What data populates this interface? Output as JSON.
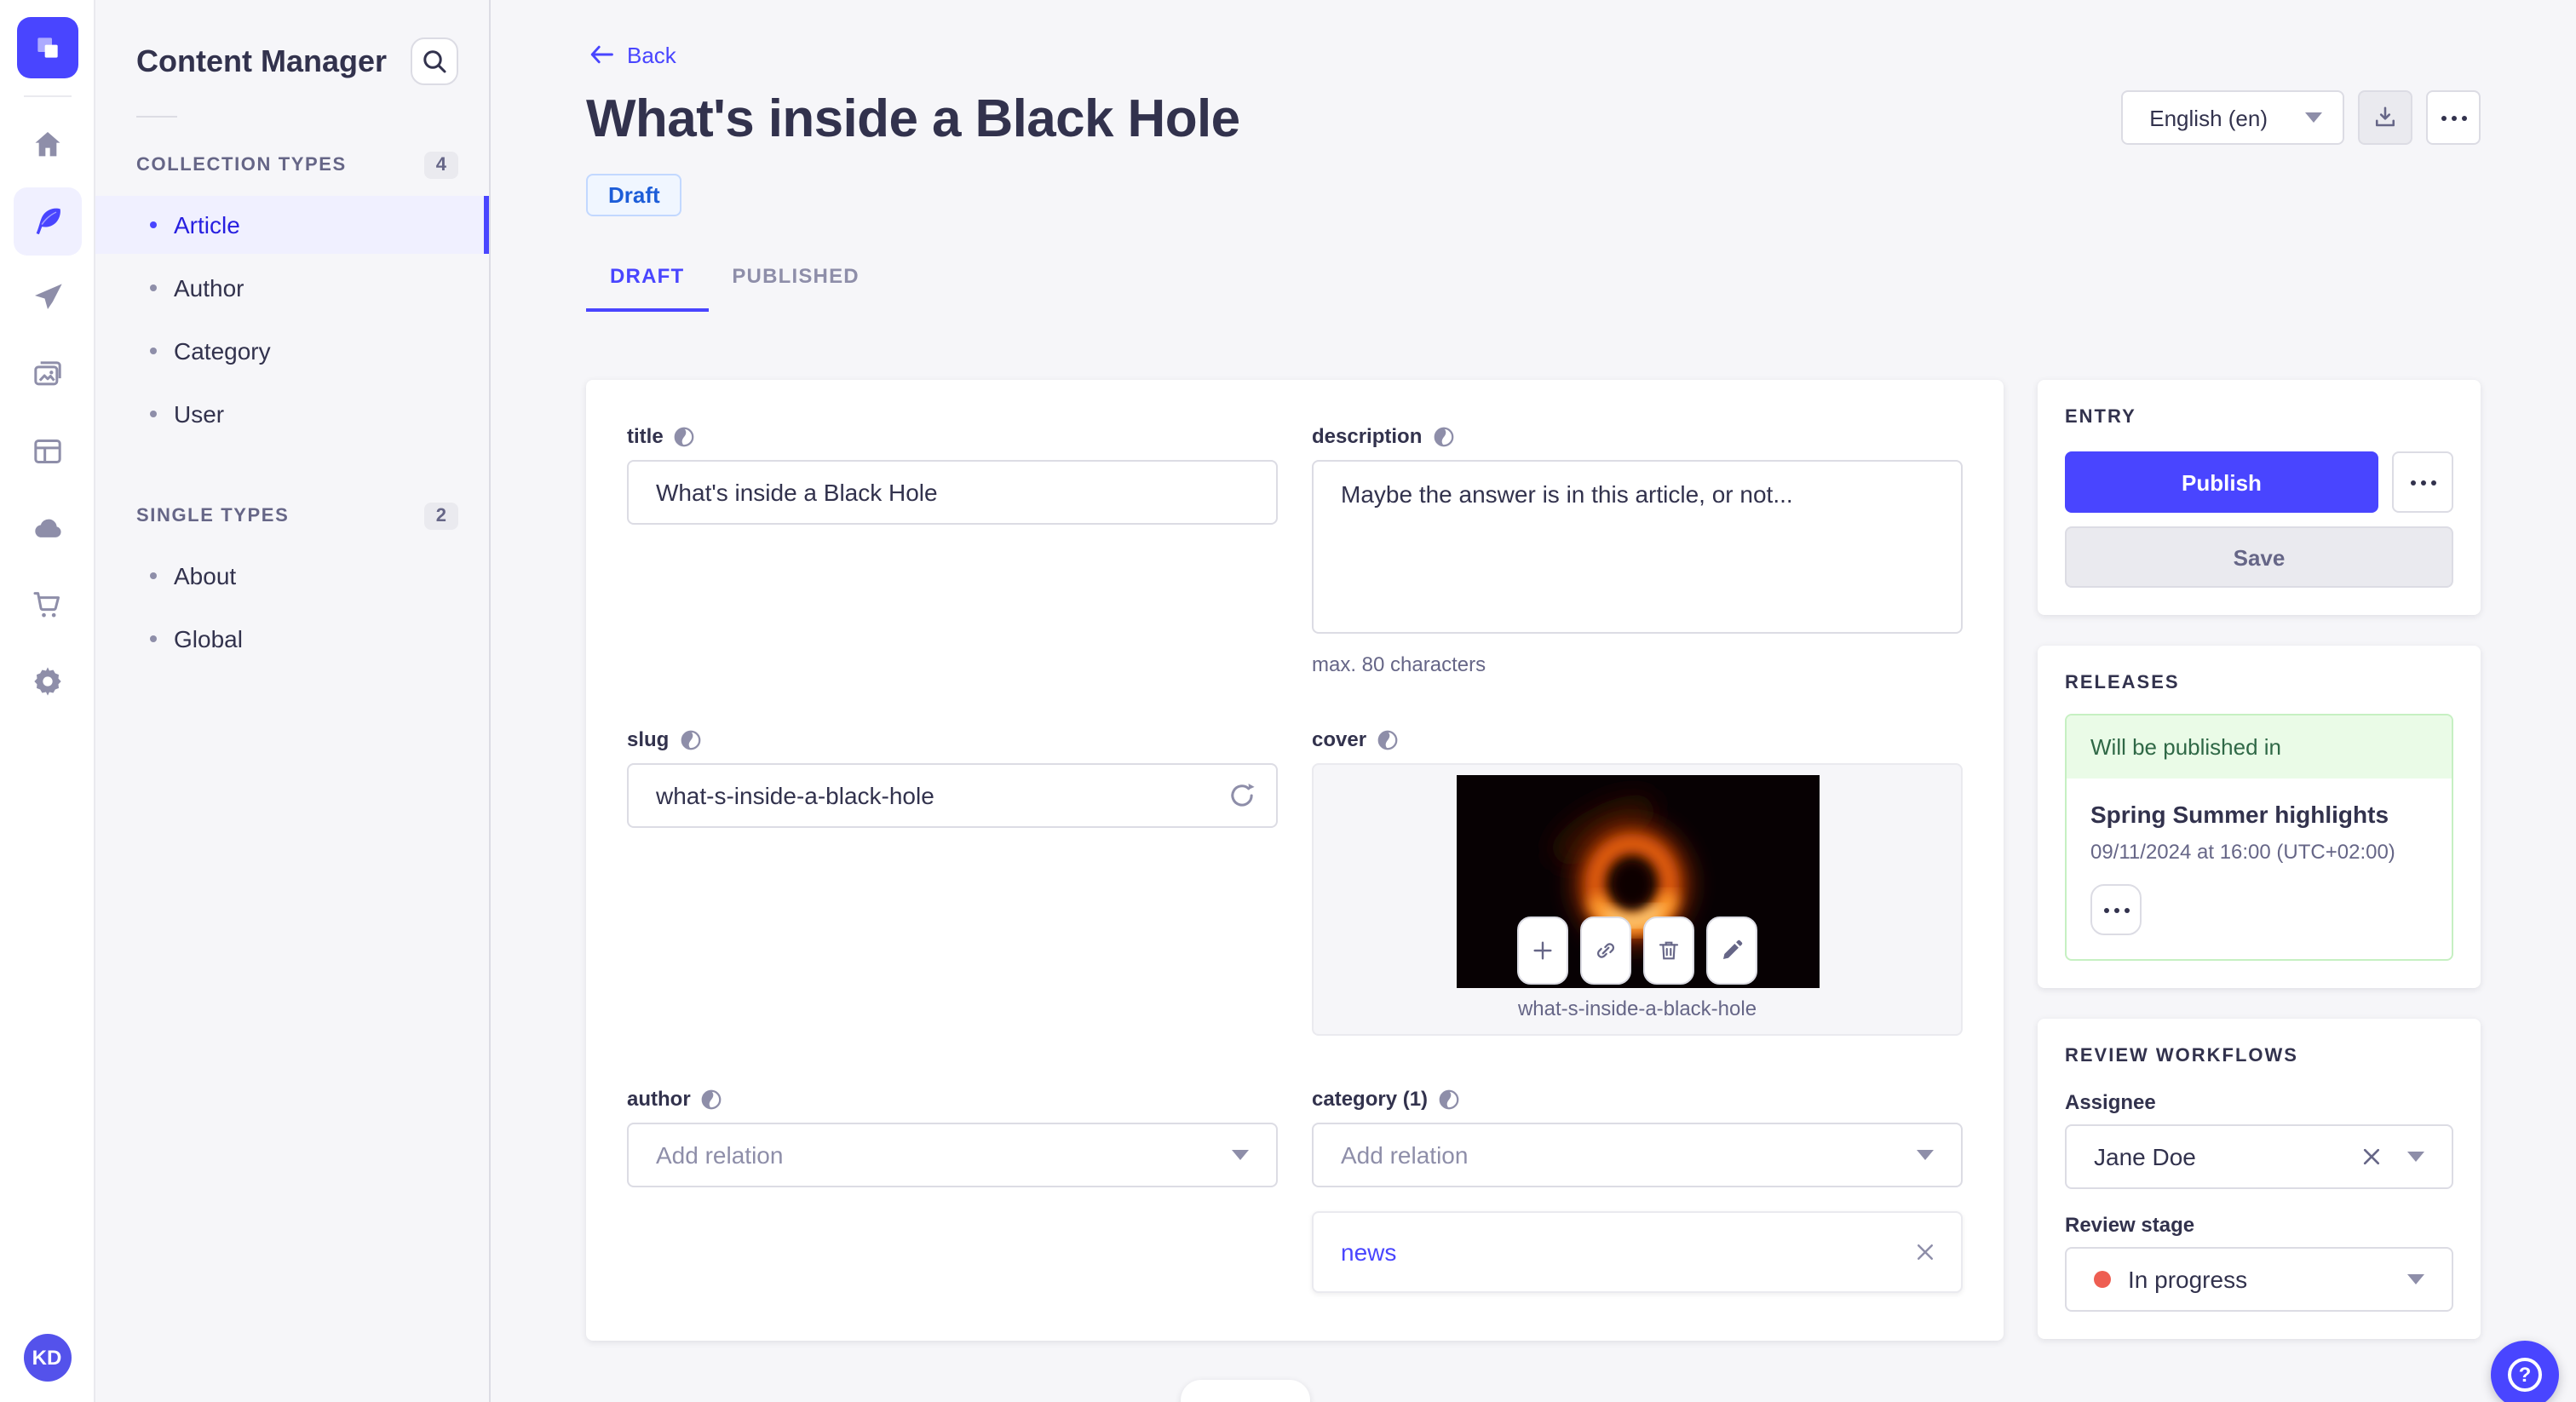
{
  "rail": {
    "items": [
      {
        "icon": "home-icon"
      },
      {
        "icon": "content-manager-feather-icon",
        "active": true
      },
      {
        "icon": "paper-plane-icon"
      },
      {
        "icon": "media-library-icon"
      },
      {
        "icon": "content-type-builder-icon"
      },
      {
        "icon": "cloud-icon"
      },
      {
        "icon": "marketplace-cart-icon"
      },
      {
        "icon": "settings-gear-icon"
      }
    ],
    "avatar_initials": "KD"
  },
  "sidebar": {
    "title": "Content Manager",
    "sections": [
      {
        "label": "COLLECTION TYPES",
        "count": "4",
        "items": [
          {
            "label": "Article",
            "active": true
          },
          {
            "label": "Author"
          },
          {
            "label": "Category"
          },
          {
            "label": "User"
          }
        ]
      },
      {
        "label": "SINGLE TYPES",
        "count": "2",
        "items": [
          {
            "label": "About"
          },
          {
            "label": "Global"
          }
        ]
      }
    ]
  },
  "header": {
    "back_label": "Back",
    "title": "What's inside a Black Hole",
    "status_badge": "Draft",
    "locale_value": "English (en)"
  },
  "tabs": {
    "draft": "DRAFT",
    "published": "PUBLISHED"
  },
  "form": {
    "title": {
      "label": "title",
      "value": "What's inside a Black Hole"
    },
    "description": {
      "label": "description",
      "value": "Maybe the answer is in this article, or not...",
      "hint": "max. 80 characters"
    },
    "slug": {
      "label": "slug",
      "value": "what-s-inside-a-black-hole"
    },
    "cover": {
      "label": "cover",
      "caption": "what-s-inside-a-black-hole"
    },
    "author": {
      "label": "author",
      "placeholder": "Add relation"
    },
    "category": {
      "label": "category (1)",
      "placeholder": "Add relation",
      "relation": "news"
    }
  },
  "entry_panel": {
    "title": "ENTRY",
    "publish_label": "Publish",
    "save_label": "Save"
  },
  "releases_panel": {
    "title": "RELEASES",
    "banner": "Will be published in",
    "release_name": "Spring Summer highlights",
    "release_date": "09/11/2024 at 16:00 (UTC+02:00)"
  },
  "review_panel": {
    "title": "REVIEW WORKFLOWS",
    "assignee_label": "Assignee",
    "assignee_value": "Jane Doe",
    "stage_label": "Review stage",
    "stage_value": "In progress"
  },
  "colors": {
    "primary": "#4945ff",
    "draft_text": "#1d5dd8",
    "release_green_text": "#2f6846",
    "release_green_bg": "#eafbe7",
    "stage_dot_red": "#ee5e52"
  }
}
